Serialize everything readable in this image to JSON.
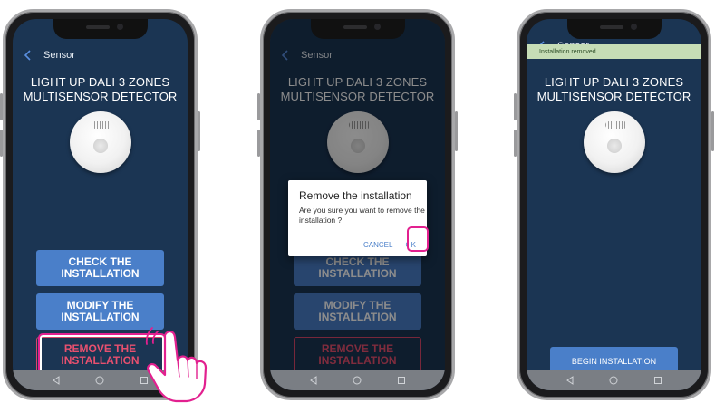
{
  "screens": [
    {
      "header": {
        "title": "Sensor"
      },
      "device_title_line1": "LIGHT UP DALI 3 ZONES",
      "device_title_line2": "MULTISENSOR DETECTOR",
      "buttons": {
        "check": "CHECK THE\nINSTALLATION",
        "modify": "MODIFY THE\nINSTALLATION",
        "remove": "REMOVE THE\nINSTALLATION"
      }
    },
    {
      "header": {
        "title": "Sensor"
      },
      "device_title_line1": "LIGHT UP DALI 3 ZONES",
      "device_title_line2": "MULTISENSOR DETECTOR",
      "buttons": {
        "check": "CHECK THE\nINSTALLATION",
        "modify": "MODIFY THE\nINSTALLATION",
        "remove": "REMOVE THE\nINSTALLATION"
      },
      "dialog": {
        "title": "Remove the installation",
        "body": "Are you sure you want to remove the installation ?",
        "cancel": "CANCEL",
        "ok": "OK"
      }
    },
    {
      "header": {
        "title": "Sensor"
      },
      "toast": "Installation removed",
      "device_title_line1": "LIGHT UP DALI 3 ZONES",
      "device_title_line2": "MULTISENSOR DETECTOR",
      "buttons": {
        "begin": "BEGIN INSTALLATION"
      }
    }
  ],
  "colors": {
    "screen_bg": "#1b3553",
    "primary_button": "#4a7fc9",
    "danger": "#e8506f",
    "highlight": "#e2208f",
    "toast_bg": "#c6ddb6"
  }
}
